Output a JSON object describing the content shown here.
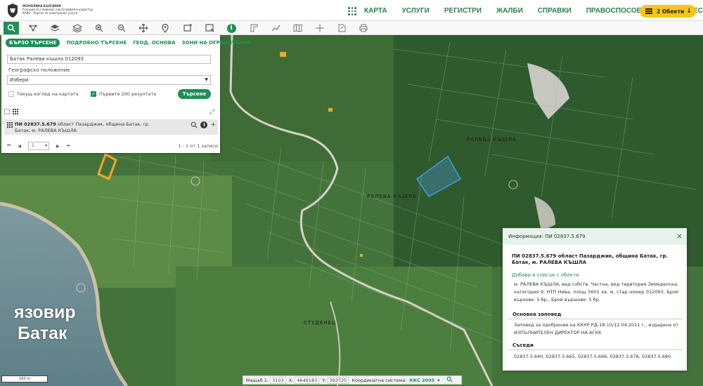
{
  "header": {
    "logo_lines": [
      "РЕПУБЛИКА БЪЛГАРИЯ",
      "Агенция по геодезия, картография и кадастър",
      "КАИС - Портал за електронни услуги"
    ],
    "nav": [
      "КАРТА",
      "УСЛУГИ",
      "РЕГИСТРИ",
      "ЖАЛБИ",
      "СПРАВКИ",
      "ПРАВОСПОСОБНИ ЛИЦА",
      "ТЕСТ"
    ],
    "objects_button": "2 Обекти"
  },
  "toolbar": {
    "tools": [
      "search-icon",
      "layers-tree-icon",
      "layers-icon",
      "stack-icon",
      "zoom-in-icon",
      "zoom-out-icon",
      "pan-icon",
      "marker-icon",
      "draw-rect-icon",
      "select-rect-icon",
      "info-icon",
      "measure-icon",
      "route-icon",
      "map-icon",
      "crosshair-icon",
      "export-icon",
      "print-icon"
    ]
  },
  "panel": {
    "tabs": [
      "БЪРЗО ТЪРСЕНЕ",
      "ПОДРОБНО ТЪРСЕНЕ",
      "ГЕОД. ОСНОВА",
      "ЗОНИ НА ОГРАНИЧЕНИЯ"
    ],
    "search_value": "Батак Ралева къшла 012093",
    "geo_label": "Географско положение",
    "geo_select": "Избери",
    "cb_current_view": "Текущ изглед на картата",
    "cb_first_200": "Първите 200 резултата",
    "search_button": "Търсене"
  },
  "results": {
    "row_id": "ПИ 02837.5.679",
    "row_text": " област Пазарджик, община Батак, гр. Батак, м. РАЛЕВА КЪШЛА",
    "page_value": "1",
    "count": "1 - 1 от 1 записи"
  },
  "map": {
    "lake_line1": "язовир",
    "lake_line2": "Батак",
    "labels": [
      "РАЛЕВА КЪШЛА",
      "РАЛЕВА КЪШЛА",
      "СТУДЕНЕЦ"
    ],
    "scale": "100 m",
    "colors": {
      "parcel": "#3ea0e0",
      "building": "#f5a623"
    }
  },
  "info": {
    "header": "Информация: ПИ 02837.5.679",
    "title": "ПИ 02837.5.679 област Пазарджик, община Батак, гр. Батак, м. РАЛЕВА КЪШЛА",
    "add_link": "Добави в списък с обекти",
    "description": "м. РАЛЕВА КЪШЛА, вид собств. Частна, вид територия Земеделска, категория 9, НТП Нива, площ 5601 кв. м, стар номер 012093, Брой върхове: 5 бр., Брой вършове: 5 бр.",
    "order_heading": "Основна заповед",
    "order_text": "Заповед за одобрение на КККР РД-18-10/12.04.2011 г., издадена от ИЗПЪЛНИТЕЛЕН ДИРЕКТОР НА АГКК",
    "neighbors_heading": "Съседи",
    "neighbors": "02837.5.640, 02837.5.665, 02837.5.666, 02837.5.678, 02837.5.680"
  },
  "statusbar": {
    "scale_label": "Мащаб 1:",
    "scale_value": "3103",
    "x_label": "X:",
    "x_value": "4649183",
    "y_label": "Y:",
    "y_value": "393725",
    "crs_label": "Координатна система:",
    "crs_value": "ККС 2005"
  }
}
